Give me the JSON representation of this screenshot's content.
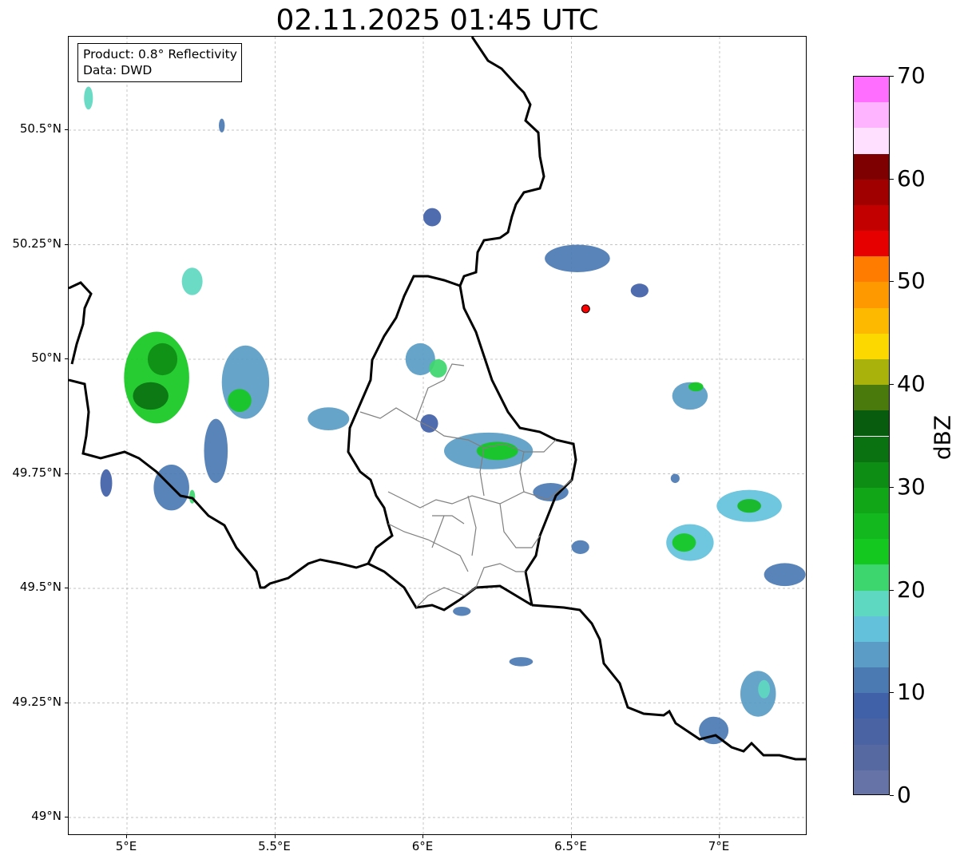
{
  "title": "02.11.2025 01:45 UTC",
  "info_box": {
    "product": "Product: 0.8° Reflectivity",
    "data": "Data: DWD"
  },
  "map": {
    "lon_range": [
      4.8,
      7.3
    ],
    "lat_range": [
      48.95,
      50.72
    ],
    "lat_ticks": [
      {
        "value": 50.5,
        "label": "50.5°N"
      },
      {
        "value": 50.25,
        "label": "50.25°N"
      },
      {
        "value": 50.0,
        "label": "50°N"
      },
      {
        "value": 49.75,
        "label": "49.75°N"
      },
      {
        "value": 49.5,
        "label": "49.5°N"
      },
      {
        "value": 49.25,
        "label": "49.25°N"
      },
      {
        "value": 49.0,
        "label": "49°N"
      }
    ],
    "lon_ticks": [
      {
        "value": 5.0,
        "label": "5°E"
      },
      {
        "value": 5.5,
        "label": "5.5°E"
      },
      {
        "value": 6.0,
        "label": "6°E"
      },
      {
        "value": 6.5,
        "label": "6.5°E"
      },
      {
        "value": 7.0,
        "label": "7°E"
      }
    ],
    "gridlines": true,
    "radar_site": {
      "lon": 6.548,
      "lat": 50.11,
      "color": "#ff0000"
    }
  },
  "colorbar": {
    "unit": "dBZ",
    "min": 0,
    "max": 70,
    "step": 2.5,
    "labels": [
      {
        "value": 0,
        "label": "0"
      },
      {
        "value": 10,
        "label": "10"
      },
      {
        "value": 20,
        "label": "20"
      },
      {
        "value": 30,
        "label": "30"
      },
      {
        "value": 40,
        "label": "40"
      },
      {
        "value": 50,
        "label": "50"
      },
      {
        "value": 60,
        "label": "60"
      },
      {
        "value": 70,
        "label": "70"
      }
    ],
    "colors": [
      "#6573a6",
      "#5669a0",
      "#4a63a3",
      "#4060a8",
      "#4b7ab3",
      "#5a9cc5",
      "#63c1dc",
      "#5ed8c0",
      "#3dd66e",
      "#14c81f",
      "#13b81e",
      "#11a618",
      "#0e8d15",
      "#0b7211",
      "#075c0d",
      "#4a7a0c",
      "#a9b20a",
      "#fdd800",
      "#fcb900",
      "#fe9a00",
      "#ff7c00",
      "#e60000",
      "#c20000",
      "#a00000",
      "#7f0000",
      "#ffe1ff",
      "#ffb4ff",
      "#ff6eff",
      "#ec37ec"
    ]
  },
  "echoes": [
    {
      "lon": 5.1,
      "lat": 49.96,
      "w": 0.22,
      "h": 0.2,
      "dbz": 24
    },
    {
      "lon": 5.12,
      "lat": 50.0,
      "w": 0.1,
      "h": 0.07,
      "dbz": 32
    },
    {
      "lon": 5.08,
      "lat": 49.92,
      "w": 0.12,
      "h": 0.06,
      "dbz": 33
    },
    {
      "lon": 5.22,
      "lat": 50.17,
      "w": 0.07,
      "h": 0.06,
      "dbz": 18
    },
    {
      "lon": 5.3,
      "lat": 49.8,
      "w": 0.08,
      "h": 0.14,
      "dbz": 12
    },
    {
      "lon": 5.4,
      "lat": 49.95,
      "w": 0.16,
      "h": 0.16,
      "dbz": 14
    },
    {
      "lon": 5.38,
      "lat": 49.91,
      "w": 0.08,
      "h": 0.05,
      "dbz": 24
    },
    {
      "lon": 5.68,
      "lat": 49.87,
      "w": 0.14,
      "h": 0.05,
      "dbz": 14
    },
    {
      "lon": 5.15,
      "lat": 49.72,
      "w": 0.12,
      "h": 0.1,
      "dbz": 11
    },
    {
      "lon": 4.93,
      "lat": 49.73,
      "w": 0.04,
      "h": 0.06,
      "dbz": 9
    },
    {
      "lon": 6.22,
      "lat": 49.8,
      "w": 0.3,
      "h": 0.08,
      "dbz": 14
    },
    {
      "lon": 6.25,
      "lat": 49.8,
      "w": 0.14,
      "h": 0.04,
      "dbz": 24
    },
    {
      "lon": 6.02,
      "lat": 49.86,
      "w": 0.06,
      "h": 0.04,
      "dbz": 9
    },
    {
      "lon": 5.99,
      "lat": 50.0,
      "w": 0.1,
      "h": 0.07,
      "dbz": 14
    },
    {
      "lon": 6.05,
      "lat": 49.98,
      "w": 0.06,
      "h": 0.04,
      "dbz": 22
    },
    {
      "lon": 6.43,
      "lat": 49.71,
      "w": 0.12,
      "h": 0.04,
      "dbz": 11
    },
    {
      "lon": 6.53,
      "lat": 49.59,
      "w": 0.06,
      "h": 0.03,
      "dbz": 10
    },
    {
      "lon": 6.9,
      "lat": 49.6,
      "w": 0.16,
      "h": 0.08,
      "dbz": 16
    },
    {
      "lon": 6.88,
      "lat": 49.6,
      "w": 0.08,
      "h": 0.04,
      "dbz": 24
    },
    {
      "lon": 7.1,
      "lat": 49.68,
      "w": 0.22,
      "h": 0.07,
      "dbz": 16
    },
    {
      "lon": 7.1,
      "lat": 49.68,
      "w": 0.08,
      "h": 0.03,
      "dbz": 26
    },
    {
      "lon": 7.22,
      "lat": 49.53,
      "w": 0.14,
      "h": 0.05,
      "dbz": 11
    },
    {
      "lon": 6.9,
      "lat": 49.92,
      "w": 0.12,
      "h": 0.06,
      "dbz": 13
    },
    {
      "lon": 6.92,
      "lat": 49.94,
      "w": 0.05,
      "h": 0.02,
      "dbz": 24
    },
    {
      "lon": 7.13,
      "lat": 49.27,
      "w": 0.12,
      "h": 0.1,
      "dbz": 14
    },
    {
      "lon": 7.15,
      "lat": 49.28,
      "w": 0.04,
      "h": 0.04,
      "dbz": 19
    },
    {
      "lon": 6.98,
      "lat": 49.19,
      "w": 0.1,
      "h": 0.06,
      "dbz": 10
    },
    {
      "lon": 6.52,
      "lat": 50.22,
      "w": 0.22,
      "h": 0.06,
      "dbz": 10
    },
    {
      "lon": 6.73,
      "lat": 50.15,
      "w": 0.06,
      "h": 0.03,
      "dbz": 9
    },
    {
      "lon": 6.03,
      "lat": 50.31,
      "w": 0.06,
      "h": 0.04,
      "dbz": 9
    },
    {
      "lon": 6.33,
      "lat": 49.34,
      "w": 0.08,
      "h": 0.02,
      "dbz": 10
    },
    {
      "lon": 6.13,
      "lat": 49.45,
      "w": 0.06,
      "h": 0.02,
      "dbz": 10
    },
    {
      "lon": 4.87,
      "lat": 50.57,
      "w": 0.03,
      "h": 0.05,
      "dbz": 18
    },
    {
      "lon": 5.32,
      "lat": 50.51,
      "w": 0.02,
      "h": 0.03,
      "dbz": 12
    },
    {
      "lon": 5.22,
      "lat": 49.7,
      "w": 0.02,
      "h": 0.03,
      "dbz": 20
    },
    {
      "lon": 6.85,
      "lat": 49.74,
      "w": 0.03,
      "h": 0.02,
      "dbz": 10
    }
  ]
}
